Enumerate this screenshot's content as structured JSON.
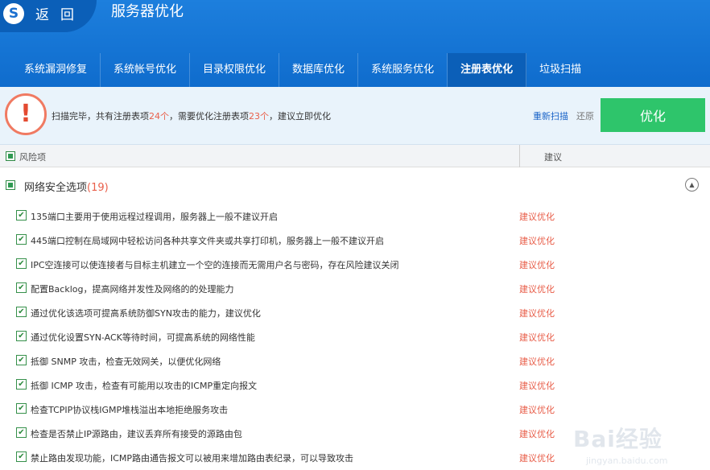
{
  "header": {
    "logo_letter": "S",
    "back_label": "返回",
    "title": "服务器优化"
  },
  "tabs": [
    {
      "label": "系统漏洞修复",
      "active": false
    },
    {
      "label": "系统帐号优化",
      "active": false
    },
    {
      "label": "目录权限优化",
      "active": false
    },
    {
      "label": "数据库优化",
      "active": false
    },
    {
      "label": "系统服务优化",
      "active": false
    },
    {
      "label": "注册表优化",
      "active": true
    },
    {
      "label": "垃圾扫描",
      "active": false
    }
  ],
  "status": {
    "icon": "warning-icon",
    "warning_mark": "!",
    "text_part1": "扫描完毕，共有注册表项",
    "total_count": "24个",
    "text_part2": "，需要优化注册表项",
    "optimize_count": "23个",
    "text_part3": "，建议立即优化",
    "rescan_label": "重新扫描",
    "restore_label": "还原",
    "optimize_label": "优化"
  },
  "columns": {
    "risk_label": "风险项",
    "advice_label": "建议"
  },
  "category": {
    "title": "网络安全选项",
    "count": "(19)",
    "collapse_glyph": "▲"
  },
  "items": [
    {
      "desc": "135端口主要用于使用远程过程调用，服务器上一般不建议开启",
      "advice": "建议优化",
      "checked": true
    },
    {
      "desc": "445端口控制在局域网中轻松访问各种共享文件夹或共享打印机，服务器上一般不建议开启",
      "advice": "建议优化",
      "checked": true
    },
    {
      "desc": "IPC空连接可以使连接者与目标主机建立一个空的连接而无需用户名与密码，存在风险建议关闭",
      "advice": "建议优化",
      "checked": true
    },
    {
      "desc": "配置Backlog，提高网络并发性及网络的的处理能力",
      "advice": "建议优化",
      "checked": true
    },
    {
      "desc": "通过优化该选项可提高系统防御SYN攻击的能力，建议优化",
      "advice": "建议优化",
      "checked": true
    },
    {
      "desc": "通过优化设置SYN-ACK等待时间，可提高系统的网络性能",
      "advice": "建议优化",
      "checked": true
    },
    {
      "desc": "抵御 SNMP 攻击，检查无效网关，以便优化网络",
      "advice": "建议优化",
      "checked": true
    },
    {
      "desc": "抵御 ICMP 攻击，检查有可能用以攻击的ICMP重定向报文",
      "advice": "建议优化",
      "checked": true
    },
    {
      "desc": "检查TCPIP协议栈IGMP堆栈溢出本地拒绝服务攻击",
      "advice": "建议优化",
      "checked": true
    },
    {
      "desc": "检查是否禁止IP源路由，建议丢弃所有接受的源路由包",
      "advice": "建议优化",
      "checked": true
    },
    {
      "desc": "禁止路由发现功能，ICMP路由通告报文可以被用来增加路由表纪录，可以导致攻击",
      "advice": "建议优化",
      "checked": true
    }
  ],
  "watermark": {
    "text": "Bai经验",
    "sub": "jingyan.baidu.com"
  },
  "colors": {
    "header_blue": "#1677d6",
    "active_tab": "#0b5fb8",
    "optimize_green": "#2ec56b",
    "warning_red": "#e95f4a",
    "link_blue": "#1a64c8"
  }
}
